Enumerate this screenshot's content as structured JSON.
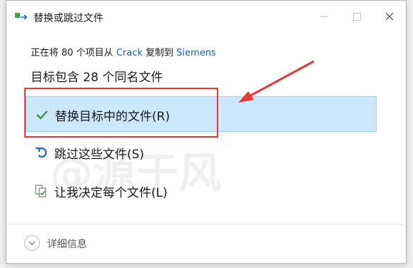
{
  "window": {
    "title": "替换或跳过文件",
    "icon": "copy-files-icon"
  },
  "dialog": {
    "copy_prefix": "正在将 80 个项目从 ",
    "source": "Crack",
    "copy_middle": " 复制到 ",
    "destination": "Siemens",
    "heading": "目标包含 28 个同名文件"
  },
  "options": [
    {
      "label": "替换目标中的文件(R)",
      "icon": "checkmark-icon",
      "color": "#3a9a3a"
    },
    {
      "label": "跳过这些文件(S)",
      "icon": "skip-arrow-icon",
      "color": "#1f6fb5"
    },
    {
      "label": "让我决定每个文件(L)",
      "icon": "file-compare-icon",
      "color": "#3a9a3a"
    }
  ],
  "footer": {
    "details_label": "详细信息"
  },
  "watermark": "@源于风",
  "colors": {
    "selected_bg": "#cce8ff",
    "annotation": "#e53935",
    "link": "#1a5fb4"
  }
}
